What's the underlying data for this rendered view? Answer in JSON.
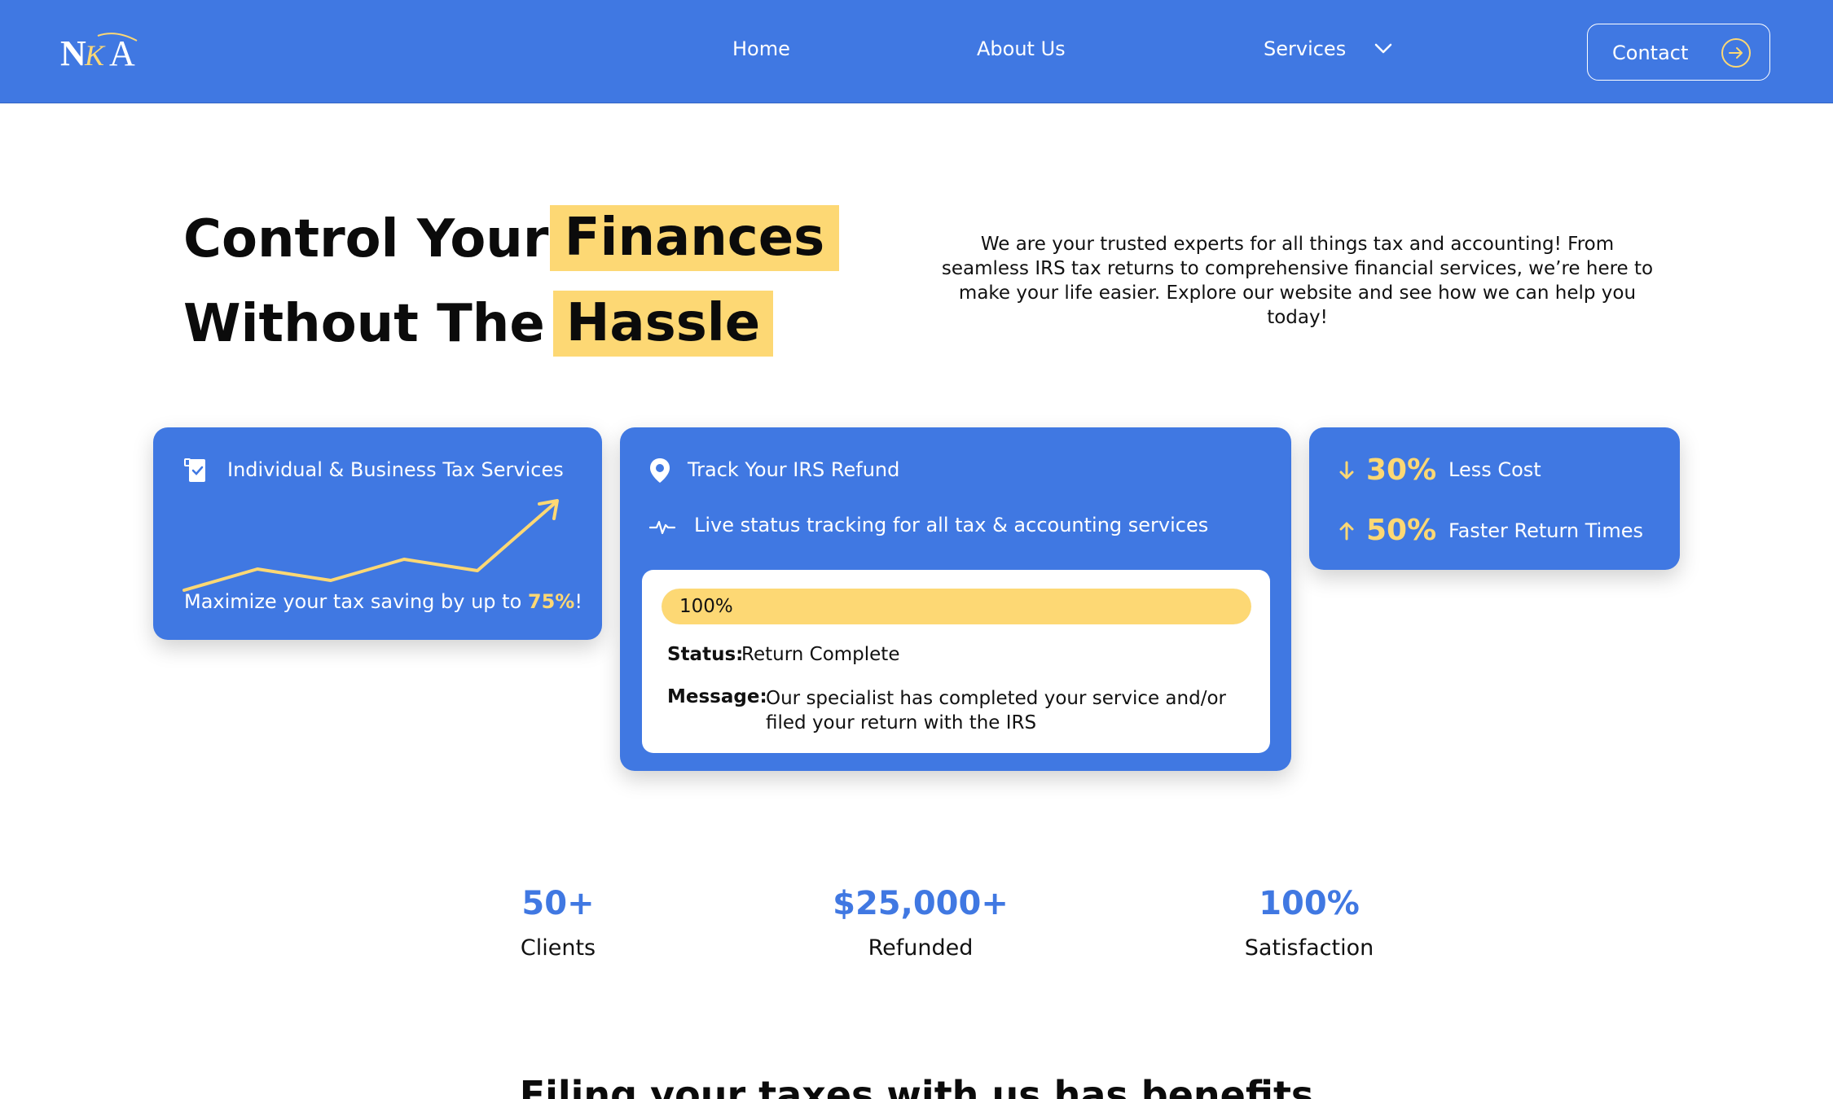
{
  "nav": {
    "logo_text": "NKA",
    "links": [
      {
        "label": "Home"
      },
      {
        "label": "About Us"
      },
      {
        "label": "Services"
      }
    ],
    "contact_label": "Contact"
  },
  "hero": {
    "line1_text": "Control Your",
    "line1_highlight": "Finances",
    "line2_text": "Without The",
    "line2_highlight": "Hassle",
    "description": "We are your trusted experts for all things tax and accounting! From seamless IRS tax returns to comprehensive financial services, we’re here to make your life easier. Explore our website and see how we can help you today!"
  },
  "tax_card": {
    "title": "Individual & Business Tax Services",
    "footer_prefix": "Maximize your tax saving by up to ",
    "footer_accent": "75%",
    "footer_suffix": "!"
  },
  "track_card": {
    "title": "Track Your IRS Refund",
    "subtitle": "Live status tracking for all tax & accounting services",
    "progress_label": "100%",
    "progress_fraction": 1.0,
    "status_label": "Status:",
    "status_value": "Return Complete",
    "message_label": "Message:",
    "message_value": "Our specialist has completed your service and/or filed your return with the IRS"
  },
  "stats_card": {
    "items": [
      {
        "direction": "down",
        "value": "30%",
        "label": "Less Cost"
      },
      {
        "direction": "up",
        "value": "50%",
        "label": "Faster Return Times"
      }
    ]
  },
  "metrics": [
    {
      "value": "50+",
      "label": "Clients"
    },
    {
      "value": "$25,000+",
      "label": "Refunded"
    },
    {
      "value": "100%",
      "label": "Satisfaction"
    }
  ],
  "benefits": {
    "heading": "Filing your taxes with us has benefits"
  },
  "colors": {
    "brand_blue": "#4078e2",
    "accent_yellow": "#fdd874",
    "text_dark": "#0b0b0b"
  },
  "icons": [
    "chevron-down-icon",
    "arrow-right-circle-icon",
    "receipt-icon",
    "trend-chart-icon",
    "location-pin-icon",
    "pulse-icon",
    "arrow-down-icon",
    "arrow-up-icon"
  ]
}
